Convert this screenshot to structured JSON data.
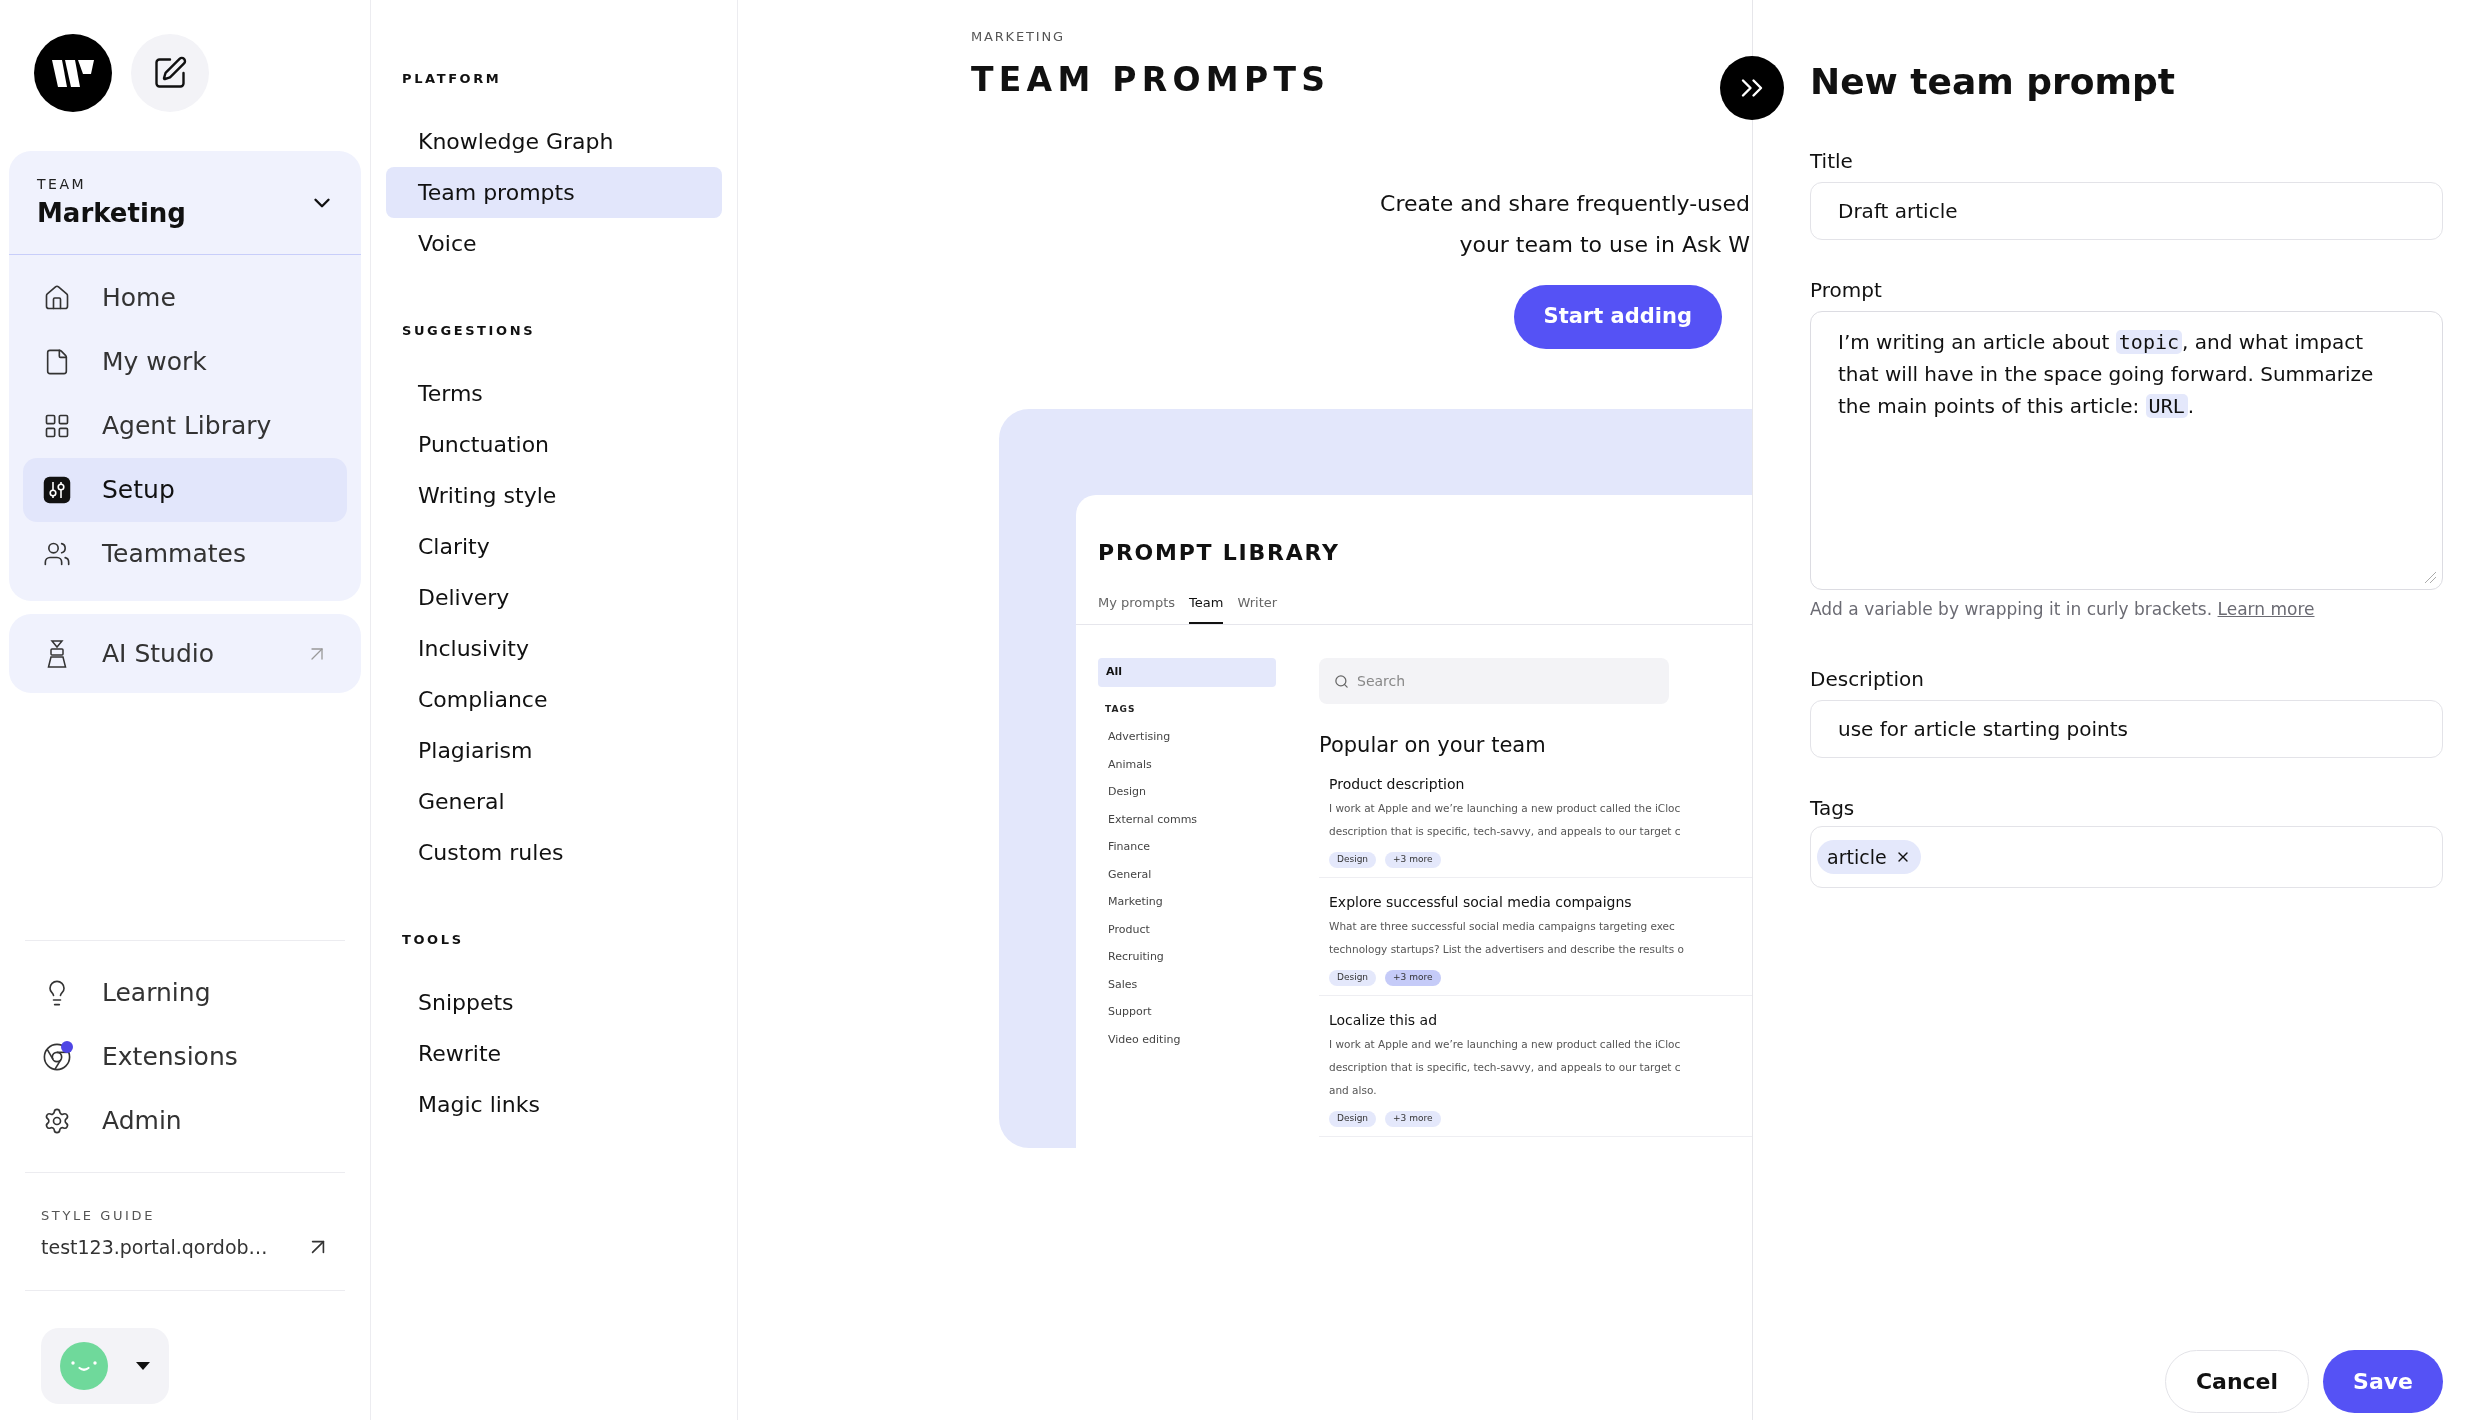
{
  "sidebar": {
    "team_switcher": {
      "label": "TEAM",
      "name": "Marketing"
    },
    "nav": [
      {
        "label": "Home",
        "selected": false
      },
      {
        "label": "My work",
        "selected": false
      },
      {
        "label": "Agent Library",
        "selected": false
      },
      {
        "label": "Setup",
        "selected": true
      },
      {
        "label": "Teammates",
        "selected": false
      }
    ],
    "ai_studio": {
      "label": "AI Studio"
    },
    "secondary_nav": [
      {
        "label": "Learning",
        "notification": false
      },
      {
        "label": "Extensions",
        "notification": true
      },
      {
        "label": "Admin",
        "notification": false
      }
    ],
    "style_guide": {
      "label": "STYLE GUIDE",
      "link": "test123.portal.qordob…"
    }
  },
  "settings_menu": [
    {
      "title": "PLATFORM",
      "items": [
        {
          "label": "Knowledge Graph",
          "selected": false
        },
        {
          "label": "Team prompts",
          "selected": true
        },
        {
          "label": "Voice",
          "selected": false
        }
      ]
    },
    {
      "title": "SUGGESTIONS",
      "items": [
        {
          "label": "Terms",
          "selected": false
        },
        {
          "label": "Punctuation",
          "selected": false
        },
        {
          "label": "Writing style",
          "selected": false
        },
        {
          "label": "Clarity",
          "selected": false
        },
        {
          "label": "Delivery",
          "selected": false
        },
        {
          "label": "Inclusivity",
          "selected": false
        },
        {
          "label": "Compliance",
          "selected": false
        },
        {
          "label": "Plagiarism",
          "selected": false
        },
        {
          "label": "General",
          "selected": false
        },
        {
          "label": "Custom rules",
          "selected": false
        }
      ]
    },
    {
      "title": "TOOLS",
      "items": [
        {
          "label": "Snippets",
          "selected": false
        },
        {
          "label": "Rewrite",
          "selected": false
        },
        {
          "label": "Magic links",
          "selected": false
        }
      ]
    }
  ],
  "page": {
    "eyebrow": "MARKETING",
    "title": "TEAM PROMPTS",
    "intro_lines": [
      "Create and share frequently-used",
      "your team to use in Ask W"
    ],
    "start_button": "Start adding",
    "preview": {
      "title": "PROMPT LIBRARY",
      "tabs": [
        {
          "label": "My prompts",
          "selected": false
        },
        {
          "label": "Team",
          "selected": true
        },
        {
          "label": "Writer",
          "selected": false
        }
      ],
      "all_filter": {
        "label": "All",
        "selected": true
      },
      "tags_heading": "TAGS",
      "tags": [
        {
          "label": "Advertising",
          "selected": false
        },
        {
          "label": "Animals",
          "selected": false
        },
        {
          "label": "Design",
          "selected": false
        },
        {
          "label": "External comms",
          "selected": false
        },
        {
          "label": "Finance",
          "selected": false
        },
        {
          "label": "General",
          "selected": false
        },
        {
          "label": "Marketing",
          "selected": false
        },
        {
          "label": "Product",
          "selected": false
        },
        {
          "label": "Recruiting",
          "selected": false
        },
        {
          "label": "Sales",
          "selected": false
        },
        {
          "label": "Support",
          "selected": false
        },
        {
          "label": "Video editing",
          "selected": false
        }
      ],
      "search": {
        "placeholder": "Search"
      },
      "section_title": "Popular on your team",
      "prompts": [
        {
          "title": "Product description",
          "lines": [
            "I work at Apple and we’re launching a new product called the iCloc",
            "description that is specific, tech-savvy, and appeals to our target c"
          ],
          "tags": [
            {
              "label": "Design",
              "highlighted": false
            },
            {
              "label": "+3 more",
              "highlighted": false
            }
          ]
        },
        {
          "title": "Explore successful social media compaigns",
          "lines": [
            "What are three successful social media campaigns targeting exec",
            "technology startups? List the advertisers and describe the results o"
          ],
          "tags": [
            {
              "label": "Design",
              "highlighted": false
            },
            {
              "label": "+3 more",
              "highlighted": true
            }
          ]
        },
        {
          "title": "Localize this ad",
          "lines": [
            "I work at Apple and we’re launching a new product called the iCloc",
            "description that is specific, tech-savvy, and appeals to our target c",
            "and also."
          ],
          "tags": [
            {
              "label": "Design",
              "highlighted": false
            },
            {
              "label": "+3 more",
              "highlighted": false
            }
          ]
        }
      ]
    }
  },
  "panel": {
    "title": "New team prompt",
    "title_field": {
      "label": "Title",
      "value": "Draft article"
    },
    "prompt_field": {
      "label": "Prompt",
      "segments": [
        {
          "kind": "text",
          "text": "I’m writing an article about "
        },
        {
          "kind": "variable",
          "text": "topic"
        },
        {
          "kind": "text",
          "text": ", and what impact that will have in the space going forward. Summarize the main points of this article: "
        },
        {
          "kind": "variable",
          "text": "URL"
        },
        {
          "kind": "text",
          "text": "."
        }
      ]
    },
    "hint": {
      "text": "Add a variable by wrapping it in curly brackets.",
      "link": "Learn more"
    },
    "description_field": {
      "label": "Description",
      "value": "use for article starting points"
    },
    "tags_field": {
      "label": "Tags",
      "tags": [
        "article"
      ]
    },
    "buttons": [
      {
        "label": "Cancel",
        "kind": "secondary"
      },
      {
        "label": "Save",
        "kind": "primary"
      }
    ]
  }
}
